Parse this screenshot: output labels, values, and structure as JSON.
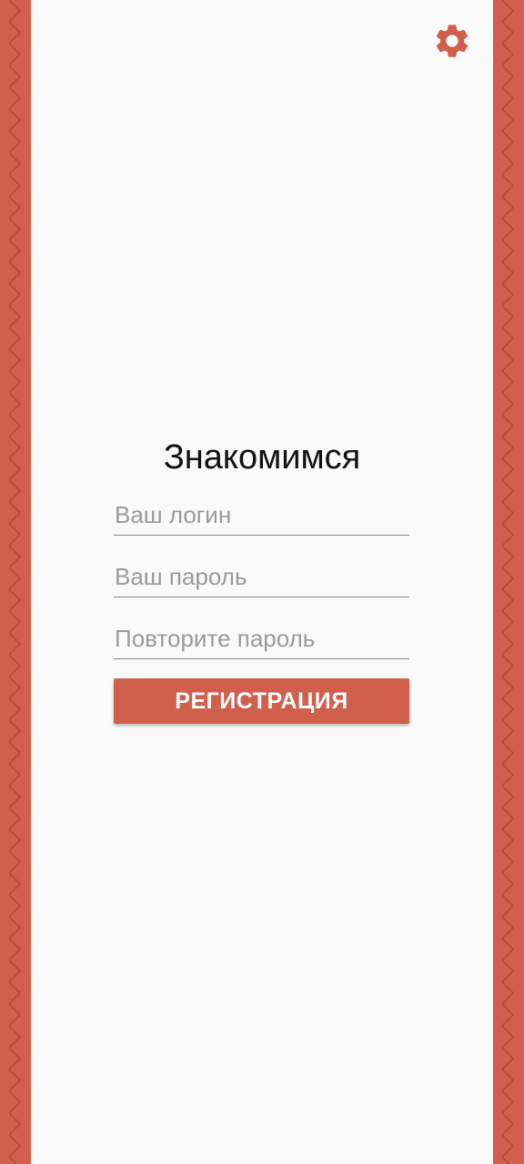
{
  "colors": {
    "accent": "#d05f4c",
    "background": "#fafafa",
    "border_pattern": "#b14a39"
  },
  "settings": {
    "icon": "gear-icon"
  },
  "page": {
    "title": "Знакомимся"
  },
  "form": {
    "login_placeholder": "Ваш логин",
    "password_placeholder": "Ваш пароль",
    "repeat_password_placeholder": "Повторите пароль",
    "register_label": "РЕГИСТРАЦИЯ"
  }
}
